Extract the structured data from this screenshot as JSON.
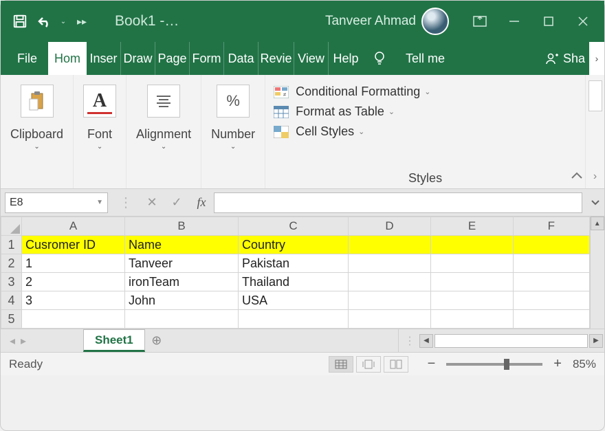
{
  "titlebar": {
    "doc_title": "Book1  -…",
    "user_name": "Tanveer Ahmad"
  },
  "tabs": {
    "file": "File",
    "home": "Home",
    "insert": "Insert",
    "draw": "Draw",
    "page": "Page",
    "formulas": "Formulas",
    "data": "Data",
    "review": "Review",
    "view": "View",
    "help": "Help",
    "tell_me": "Tell me",
    "share": "Share"
  },
  "ribbon": {
    "clipboard": "Clipboard",
    "font": "Font",
    "alignment": "Alignment",
    "number": "Number",
    "number_glyph": "%",
    "cond_fmt": "Conditional Formatting",
    "fmt_table": "Format as Table",
    "cell_styles": "Cell Styles",
    "styles": "Styles"
  },
  "formula_bar": {
    "name_box": "E8",
    "fx_label": "fx",
    "formula_value": ""
  },
  "grid": {
    "columns": [
      "A",
      "B",
      "C",
      "D",
      "E",
      "F"
    ],
    "row_headers": [
      "1",
      "2",
      "3",
      "4",
      "5"
    ],
    "header_row": {
      "a": "Cusromer ID",
      "b": "Name",
      "c": "Country"
    },
    "rows": [
      {
        "id": "1",
        "name": "Tanveer",
        "country": "Pakistan"
      },
      {
        "id": "2",
        "name": "ironTeam",
        "country": "Thailand"
      },
      {
        "id": "3",
        "name": "John",
        "country": "USA"
      }
    ]
  },
  "sheets": {
    "active": "Sheet1"
  },
  "status": {
    "ready": "Ready",
    "zoom": "85%"
  }
}
